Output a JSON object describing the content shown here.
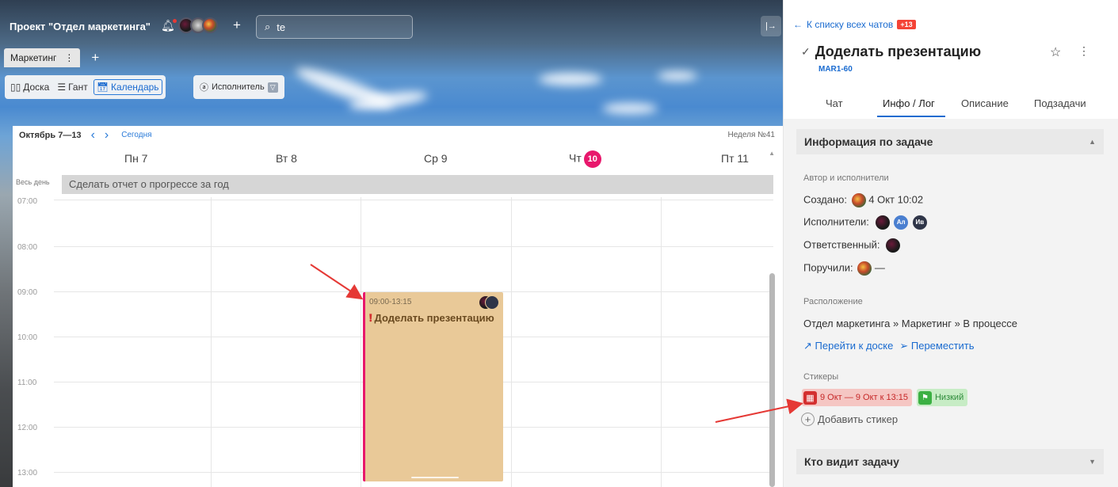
{
  "project": {
    "title": "Проект \"Отдел маркетинга\"",
    "search_value": "te",
    "tab_label": "Маркетинг"
  },
  "views": [
    {
      "label": "Доска",
      "icon": "board-icon"
    },
    {
      "label": "Гант",
      "icon": "gantt-icon"
    },
    {
      "label": "Календарь",
      "icon": "calendar-icon",
      "active": true
    }
  ],
  "filter": {
    "label": "Исполнитель"
  },
  "calendar": {
    "range": "Октябрь 7—13",
    "today_label": "Сегодня",
    "week_label": "Неделя №41",
    "days": [
      {
        "label": "Пн 7"
      },
      {
        "label": "Вт 8"
      },
      {
        "label": "Ср 9"
      },
      {
        "label": "Чт",
        "badge": "10"
      },
      {
        "label": "Пт 11"
      }
    ],
    "allday_label": "Весь день",
    "allday_event": "Сделать отчет о прогрессе за год",
    "hours": [
      "07:00",
      "08:00",
      "09:00",
      "10:00",
      "11:00",
      "12:00",
      "13:00"
    ],
    "event": {
      "time": "09:00-13:15",
      "title": "Доделать презентацию"
    }
  },
  "panel": {
    "back_label": "К списку всех чатов",
    "unread_badge": "+13",
    "task_title": "Доделать презентацию",
    "task_code": "MAR1-60",
    "tabs": [
      "Чат",
      "Инфо / Лог",
      "Описание",
      "Подзадачи"
    ],
    "active_tab": "Инфо / Лог",
    "info_section": "Информация по задаче",
    "authors_label": "Автор и исполнители",
    "created_label": "Создано:",
    "created_value": "4 Окт 10:02",
    "executors_label": "Исполнители:",
    "executor_initials": [
      "Ал",
      "Ив"
    ],
    "responsible_label": "Ответственный:",
    "assigned_label": "Поручили:",
    "assigned_value": "—",
    "location_label": "Расположение",
    "location_value": "Отдел маркетинга » Маркетинг » В процессе",
    "goto_board": "Перейти к доске",
    "move": "Переместить",
    "stickers_label": "Стикеры",
    "sticker_date": "9 Окт — 9 Окт к 13:15",
    "sticker_priority": "Низкий",
    "add_sticker": "Добавить стикер",
    "visibility_section": "Кто видит задачу"
  },
  "colors": {
    "accent": "#1a6bd0",
    "today_badge": "#e8186c",
    "event_bg": "#e9c998",
    "annotation_arrow": "#e53935"
  }
}
